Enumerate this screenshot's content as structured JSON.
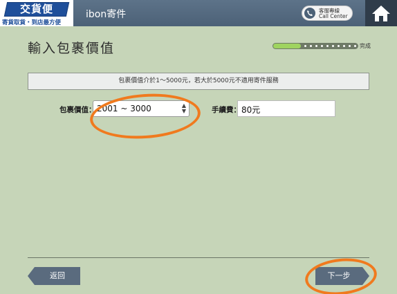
{
  "header": {
    "logo_title": "交貨便",
    "logo_subtitle": "寄貨取貨・到店最方便",
    "title": "ibon寄件",
    "call_center": {
      "line1": "客服專線",
      "line2": "Call Center",
      "icon": "phone-icon"
    },
    "home_icon": "home-icon"
  },
  "page": {
    "title": "輸入包裹價值",
    "progress": {
      "label": "完成",
      "fraction": 0.33
    },
    "notice": "包裹價值介於1～5000元，若大於5000元不適用寄件服務"
  },
  "form": {
    "value_label": "包裹價值：",
    "value_selected": "2001 ~ 3000",
    "fee_label": "手續費：",
    "fee_value": "80元"
  },
  "footer": {
    "back_label": "返回",
    "next_label": "下一步"
  },
  "colors": {
    "background": "#c6d5b8",
    "header": "#4c6177",
    "button": "#5a6b7e",
    "highlight": "#f07a1e",
    "progress": "#9fd45f"
  }
}
